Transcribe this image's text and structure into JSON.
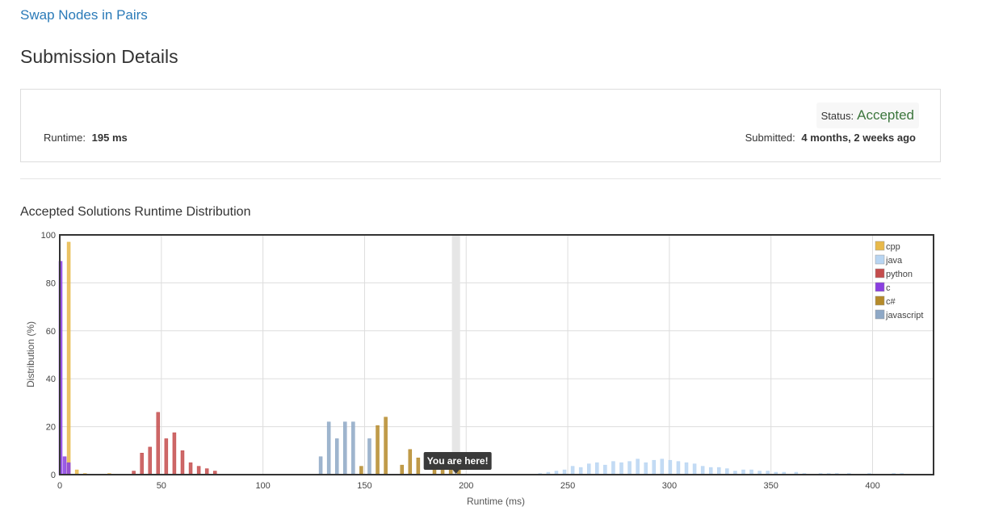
{
  "problem_link": "Swap Nodes in Pairs",
  "page_title": "Submission Details",
  "details": {
    "status_label": "Status:",
    "status_value": "Accepted",
    "runtime_label": "Runtime:",
    "runtime_value": "195 ms",
    "submitted_label": "Submitted:",
    "submitted_value": "4 months, 2 weeks ago"
  },
  "chart_title": "Accepted Solutions Runtime Distribution",
  "colors": {
    "cpp": "#e8b94a",
    "java": "#b8d5f2",
    "python": "#c44c4c",
    "c": "#8a3fe0",
    "csharp": "#b58a2a",
    "javascript": "#8ea8c6"
  },
  "chart_data": {
    "type": "bar",
    "xlabel": "Runtime (ms)",
    "ylabel": "Distribution (%)",
    "xlim": [
      0,
      430
    ],
    "ylim": [
      0,
      100
    ],
    "x_ticks": [
      0,
      50,
      100,
      150,
      200,
      250,
      300,
      350,
      400
    ],
    "y_ticks": [
      0,
      20,
      40,
      60,
      80,
      100
    ],
    "grid": true,
    "legend_position": "top-right",
    "highlight": {
      "x": 195,
      "label": "You are here!"
    },
    "series": [
      {
        "name": "cpp",
        "color": "#e8b94a",
        "points": [
          [
            4,
            97
          ],
          [
            8,
            2
          ],
          [
            12,
            0.5
          ],
          [
            24,
            0.5
          ]
        ]
      },
      {
        "name": "java",
        "color": "#b8d5f2",
        "points": [
          [
            236,
            0.5
          ],
          [
            240,
            1
          ],
          [
            244,
            1.5
          ],
          [
            248,
            2
          ],
          [
            252,
            3.5
          ],
          [
            256,
            3
          ],
          [
            260,
            4.5
          ],
          [
            264,
            5
          ],
          [
            268,
            4
          ],
          [
            272,
            5.5
          ],
          [
            276,
            5
          ],
          [
            280,
            5.5
          ],
          [
            284,
            6.5
          ],
          [
            288,
            5
          ],
          [
            292,
            6
          ],
          [
            296,
            6.5
          ],
          [
            300,
            6
          ],
          [
            304,
            5.5
          ],
          [
            308,
            5
          ],
          [
            312,
            4.5
          ],
          [
            316,
            3.5
          ],
          [
            320,
            3
          ],
          [
            324,
            3
          ],
          [
            328,
            2.5
          ],
          [
            332,
            1.5
          ],
          [
            336,
            2
          ],
          [
            340,
            2
          ],
          [
            344,
            1.5
          ],
          [
            348,
            1.5
          ],
          [
            352,
            1
          ],
          [
            356,
            1
          ],
          [
            362,
            1
          ],
          [
            366,
            0.5
          ],
          [
            374,
            0.5
          ],
          [
            378,
            0.5
          ],
          [
            382,
            0.5
          ],
          [
            388,
            0.5
          ],
          [
            398,
            0.5
          ],
          [
            410,
            0.5
          ],
          [
            414,
            0.5
          ]
        ]
      },
      {
        "name": "python",
        "color": "#c44c4c",
        "points": [
          [
            36,
            1.5
          ],
          [
            40,
            9
          ],
          [
            44,
            11.5
          ],
          [
            48,
            26
          ],
          [
            52,
            15
          ],
          [
            56,
            17.5
          ],
          [
            60,
            10
          ],
          [
            64,
            5
          ],
          [
            68,
            3.5
          ],
          [
            72,
            2.5
          ],
          [
            76,
            1.5
          ]
        ]
      },
      {
        "name": "c",
        "color": "#8a3fe0",
        "points": [
          [
            0,
            89
          ],
          [
            2,
            7.5
          ],
          [
            4,
            5
          ]
        ]
      },
      {
        "name": "c#",
        "color": "#b58a2a",
        "points": [
          [
            148,
            3.5
          ],
          [
            156,
            20.5
          ],
          [
            160,
            24
          ],
          [
            168,
            4
          ],
          [
            172,
            10.5
          ],
          [
            176,
            7
          ],
          [
            184,
            4
          ],
          [
            188,
            3.5
          ],
          [
            192,
            3
          ],
          [
            196,
            2
          ]
        ]
      },
      {
        "name": "javascript",
        "color": "#8ea8c6",
        "points": [
          [
            128,
            7.5
          ],
          [
            132,
            22
          ],
          [
            136,
            15
          ],
          [
            140,
            22
          ],
          [
            144,
            22
          ],
          [
            152,
            15
          ]
        ]
      }
    ]
  }
}
